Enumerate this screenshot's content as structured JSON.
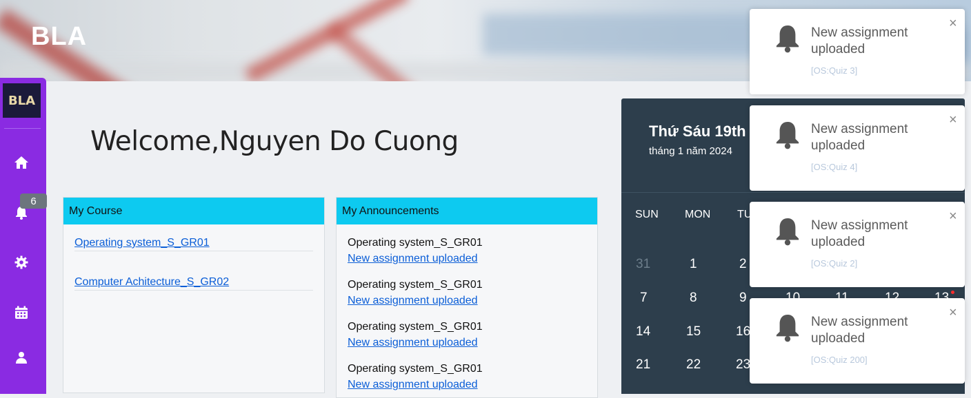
{
  "brand": "BLA",
  "sidebar": {
    "logo_text": "BLA",
    "icons": [
      "home-icon",
      "bell-icon",
      "gear-icon",
      "calendar-icon",
      "user-icon"
    ],
    "notification_count": "6"
  },
  "welcome": "Welcome,Nguyen Do Cuong",
  "my_course": {
    "title": "My Course",
    "items": [
      "Operating system_S_GR01",
      "Computer Achitecture_S_GR02"
    ]
  },
  "announcements": {
    "title": "My Announcements",
    "items": [
      {
        "course": "Operating system_S_GR01",
        "link": "New assignment uploaded"
      },
      {
        "course": "Operating system_S_GR01",
        "link": "New assignment uploaded"
      },
      {
        "course": "Operating system_S_GR01",
        "link": "New assignment uploaded"
      },
      {
        "course": "Operating system_S_GR01",
        "link": "New assignment uploaded"
      }
    ]
  },
  "calendar": {
    "day_label": "Thứ Sáu 19th",
    "month_label": "tháng 1 năm 2024",
    "weekdays": [
      "SUN",
      "MON",
      "TU"
    ],
    "rows": [
      [
        "31",
        "1",
        "2"
      ],
      [
        "7",
        "8",
        "9",
        "10",
        "11",
        "12",
        "13"
      ],
      [
        "14",
        "15",
        "16"
      ],
      [
        "21",
        "22",
        "23"
      ]
    ]
  },
  "toasts": [
    {
      "title": "New assignment uploaded",
      "sub": "[OS:Quiz 3]"
    },
    {
      "title": "New assignment uploaded",
      "sub": "[OS:Quiz 4]"
    },
    {
      "title": "New assignment uploaded",
      "sub": "[OS:Quiz 2]"
    },
    {
      "title": "New assignment uploaded",
      "sub": "[OS:Quiz 200]"
    }
  ],
  "colors": {
    "sidebar": "#8a2be2",
    "card_header": "#0dcaf0",
    "calendar_bg": "#2d3e4c",
    "link": "#0b5ed7"
  }
}
